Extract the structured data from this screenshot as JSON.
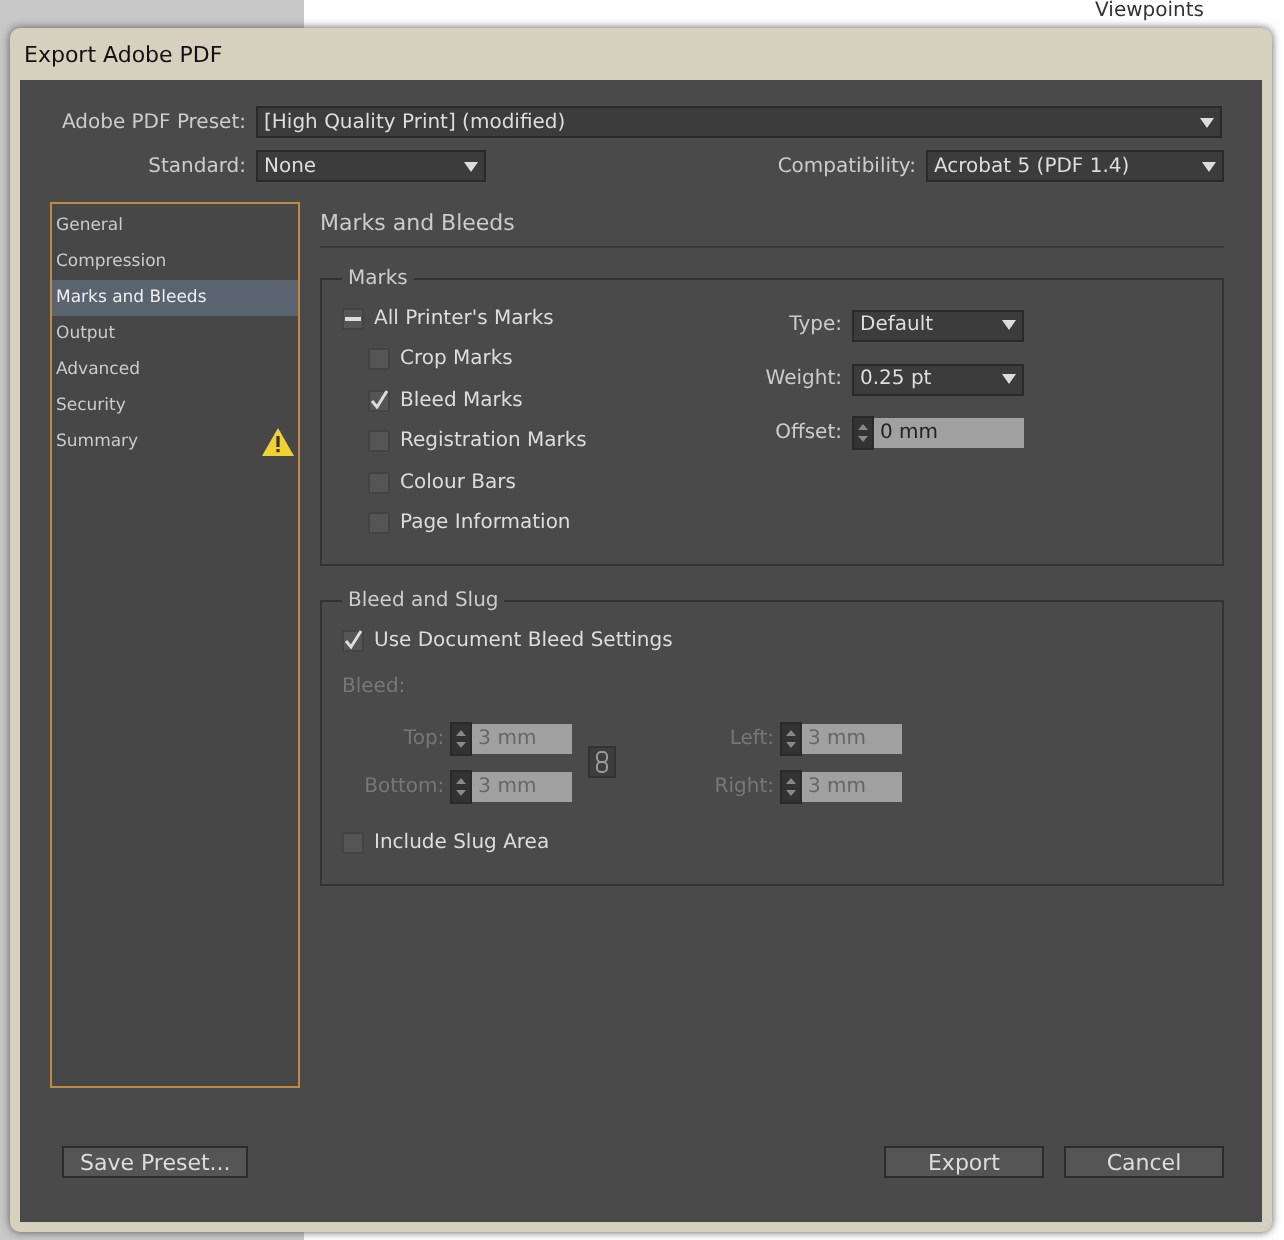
{
  "background_text": "Viewpoints",
  "window": {
    "title": "Export Adobe PDF"
  },
  "preset": {
    "label": "Adobe PDF Preset:",
    "value": "[High Quality Print] (modified)"
  },
  "standard": {
    "label": "Standard:",
    "value": "None"
  },
  "compatibility": {
    "label": "Compatibility:",
    "value": "Acrobat 5 (PDF 1.4)"
  },
  "sidebar": {
    "items": [
      {
        "label": "General",
        "selected": false,
        "warning": false
      },
      {
        "label": "Compression",
        "selected": false,
        "warning": false
      },
      {
        "label": "Marks and Bleeds",
        "selected": true,
        "warning": false
      },
      {
        "label": "Output",
        "selected": false,
        "warning": false
      },
      {
        "label": "Advanced",
        "selected": false,
        "warning": false
      },
      {
        "label": "Security",
        "selected": false,
        "warning": false
      },
      {
        "label": "Summary",
        "selected": false,
        "warning": true
      }
    ]
  },
  "page_title": "Marks and Bleeds",
  "marks": {
    "title": "Marks",
    "checkboxes": [
      {
        "kind": "parent",
        "label": "All Printer's Marks",
        "checked": true
      },
      {
        "kind": "child",
        "label": "Crop Marks",
        "checked": false
      },
      {
        "kind": "child",
        "label": "Bleed Marks",
        "checked": true
      },
      {
        "kind": "child",
        "label": "Registration Marks",
        "checked": false
      },
      {
        "kind": "child",
        "label": "Colour Bars",
        "checked": false
      },
      {
        "kind": "child",
        "label": "Page Information",
        "checked": false
      }
    ],
    "fields": [
      {
        "kind": "dropdown",
        "label": "Type:",
        "value": "Default"
      },
      {
        "kind": "dropdown",
        "label": "Weight:",
        "value": "0.25 pt"
      },
      {
        "kind": "spinner",
        "label": "Offset:",
        "value": "0 mm"
      }
    ]
  },
  "bleed_and_slug": {
    "title": "Bleed and Slug",
    "use_document_bleed": {
      "label": "Use Document Bleed Settings",
      "checked": true
    },
    "bleed_label": "Bleed:",
    "fields": [
      {
        "label": "Top:",
        "value": "3 mm",
        "disabled": true
      },
      {
        "label": "Left:",
        "value": "3 mm",
        "disabled": true
      },
      {
        "label": "Bottom:",
        "value": "3 mm",
        "disabled": true
      },
      {
        "label": "Right:",
        "value": "3 mm",
        "disabled": true
      }
    ],
    "include_slug": {
      "label": "Include Slug Area",
      "checked": false
    }
  },
  "buttons": {
    "save_preset": "Save Preset...",
    "export": "Export",
    "cancel": "Cancel"
  }
}
